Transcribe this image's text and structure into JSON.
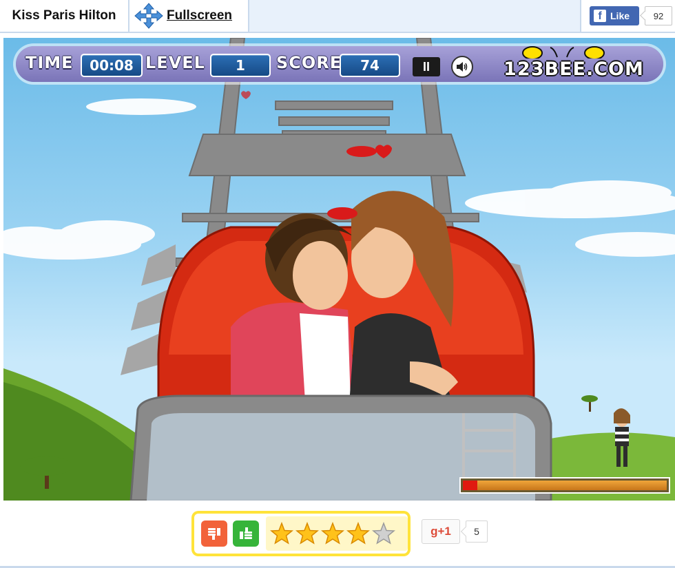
{
  "header": {
    "game_title": "Kiss Paris Hilton",
    "fullscreen_label": "Fullscreen",
    "facebook": {
      "like_label": "Like",
      "like_count": "92"
    }
  },
  "hud": {
    "time_label": "TIME",
    "time_value": "00:08",
    "level_label": "LEVEL",
    "level_value": "1",
    "score_label": "SCORE",
    "score_value": "74",
    "pause_label": "II",
    "brand": "123BEE.COM"
  },
  "kiss_meter": {
    "fill_fraction": 0.07
  },
  "rating": {
    "stars_filled": 4,
    "stars_total": 5,
    "gplus_label": "g+1",
    "gplus_count": "5"
  },
  "colors": {
    "hud_bg": "#8f89c9",
    "hud_box": "#1f5a9c",
    "fb_blue": "#4267b2",
    "rating_frame": "#ffe33a",
    "vote_down": "#f2623a",
    "vote_up": "#36b43a",
    "meter_fill": "#e01a10"
  },
  "icons": {
    "fullscreen": "move-arrows-icon",
    "sound": "speaker-icon",
    "vote_down": "thumbs-down-icon",
    "vote_up": "thumbs-up-icon",
    "star": "star-icon"
  }
}
